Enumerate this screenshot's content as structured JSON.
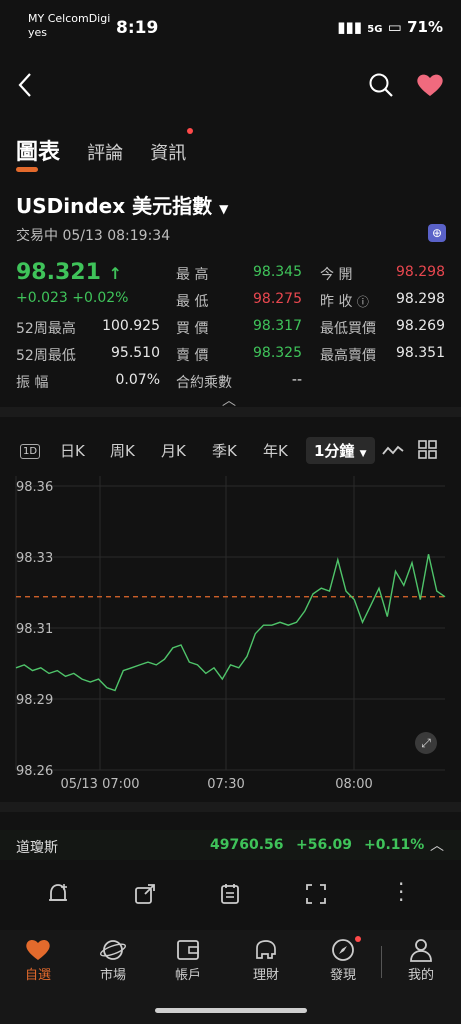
{
  "status": {
    "carrier_line1": "MY CelcomDigi",
    "carrier_line2": "yes",
    "time": "8:19",
    "battery": "71%",
    "net": "5G"
  },
  "tabs": [
    "圖表",
    "評論",
    "資訊"
  ],
  "title": "USDindex  美元指數",
  "subtitle": "交易中  05/13 08:19:34",
  "price": "98.321",
  "change": "+0.023  +0.02%",
  "stats": {
    "row1": {
      "l1": "最 高",
      "v1": "98.345",
      "l2": "今 開",
      "v2": "98.298"
    },
    "row2": {
      "l1": "最 低",
      "v1": "98.275",
      "l2": "昨 收",
      "v2": "98.298"
    },
    "row3": {
      "l0": "52周最高",
      "v0": "100.925",
      "l1": "買 價",
      "v1": "98.317",
      "l2": "最低買價",
      "v2": "98.269"
    },
    "row4": {
      "l0": "52周最低",
      "v0": "95.510",
      "l1": "賣 價",
      "v1": "98.325",
      "l2": "最高賣價",
      "v2": "98.351"
    },
    "row5": {
      "l0": "振 幅",
      "v0": "0.07%",
      "l1": "合約乘數",
      "v1": "--"
    }
  },
  "toolbar": {
    "b1": "1D",
    "b2": "日K",
    "b3": "周K",
    "b4": "月K",
    "b5": "季K",
    "b6": "年K",
    "b7": "1分鐘"
  },
  "chart_data": {
    "type": "line",
    "ylabels": [
      "98.36",
      "98.33",
      "98.31",
      "98.29",
      "98.26"
    ],
    "xlabels": [
      "05/13 07:00",
      "07:30",
      "08:00"
    ],
    "ylim": [
      98.26,
      98.36
    ],
    "reference_line": 98.321,
    "values": [
      98.296,
      98.297,
      98.295,
      98.296,
      98.294,
      98.295,
      98.293,
      98.294,
      98.292,
      98.291,
      98.292,
      98.289,
      98.288,
      98.295,
      98.296,
      98.297,
      98.298,
      98.297,
      98.299,
      98.303,
      98.304,
      98.298,
      98.297,
      98.294,
      98.296,
      98.292,
      98.297,
      98.296,
      98.3,
      98.308,
      98.311,
      98.311,
      98.312,
      98.311,
      98.312,
      98.316,
      98.322,
      98.324,
      98.323,
      98.334,
      98.323,
      98.32,
      98.312,
      98.318,
      98.324,
      98.314,
      98.33,
      98.325,
      98.333,
      98.32,
      98.336,
      98.323,
      98.321
    ]
  },
  "index_bar": {
    "name": "道瓊斯",
    "value": "49760.56",
    "change": "+56.09",
    "pct": "+0.11%"
  },
  "nav": [
    "自選",
    "市場",
    "帳戶",
    "理財",
    "發現",
    "我的"
  ]
}
